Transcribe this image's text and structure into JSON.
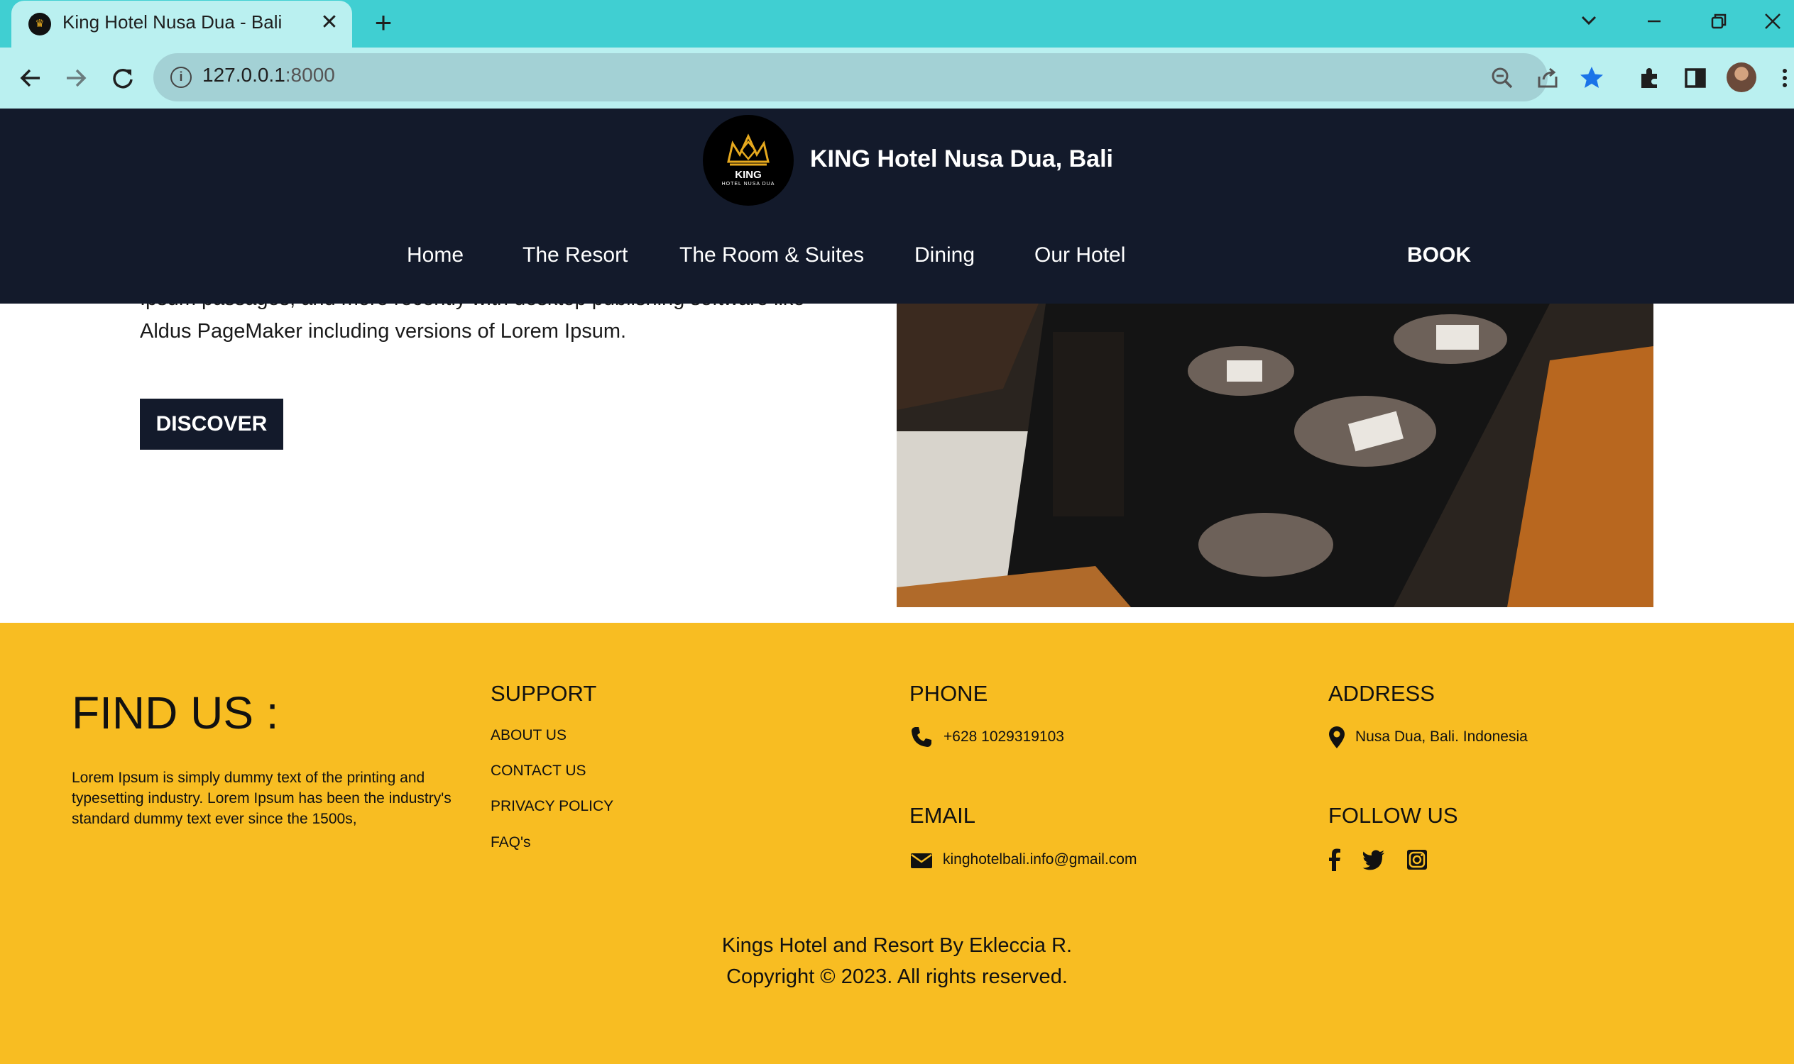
{
  "browser": {
    "tab_title": "King Hotel Nusa Dua - Bali",
    "tab_close": "✕",
    "new_tab": "+",
    "url_host": "127.0.0.1",
    "url_port": ":8000"
  },
  "header": {
    "logo_text": "KING",
    "logo_sub": "HOTEL NUSA DUA",
    "title": "KING Hotel Nusa Dua, Bali",
    "nav": {
      "home": "Home",
      "resort": "The Resort",
      "rooms": "The Room & Suites",
      "dining": "Dining",
      "our_hotel": "Our Hotel",
      "book": "BOOK"
    }
  },
  "content": {
    "paragraph_partial": "Ipsum passages, and more recently with desktop publishing software like Aldus PageMaker including versions of Lorem Ipsum.",
    "discover_label": "DISCOVER"
  },
  "footer": {
    "find_us": "FIND US :",
    "find_us_text": "Lorem Ipsum is simply dummy text of the printing and typesetting industry. Lorem Ipsum has been the industry's standard dummy text ever since the 1500s,",
    "support_heading": "SUPPORT",
    "support_links": {
      "about": "ABOUT US",
      "contact": "CONTACT US",
      "privacy": "PRIVACY POLICY",
      "faq": "FAQ's"
    },
    "phone_heading": "PHONE",
    "phone": "+628 1029319103",
    "email_heading": "EMAIL",
    "email": "kinghotelbali.info@gmail.com",
    "address_heading": "ADDRESS",
    "address": "Nusa Dua, Bali. Indonesia",
    "follow_heading": "FOLLOW US",
    "credit_line": "Kings Hotel and Resort By Ekleccia R.",
    "copyright_line": "Copyright © 2023. All rights reserved."
  },
  "colors": {
    "tabstrip": "#40cfd2",
    "toolbar": "#baf0f0",
    "header_bg": "#131a2b",
    "footer_bg": "#f8bd22",
    "bookmark_star": "#1a73e8"
  },
  "icons": [
    "back-icon",
    "forward-icon",
    "reload-icon",
    "info-icon",
    "zoom-out-icon",
    "share-icon",
    "bookmark-star-icon",
    "extensions-icon",
    "side-panel-icon",
    "menu-icon",
    "phone-icon",
    "envelope-icon",
    "map-pin-icon",
    "facebook-icon",
    "twitter-icon",
    "instagram-icon"
  ]
}
